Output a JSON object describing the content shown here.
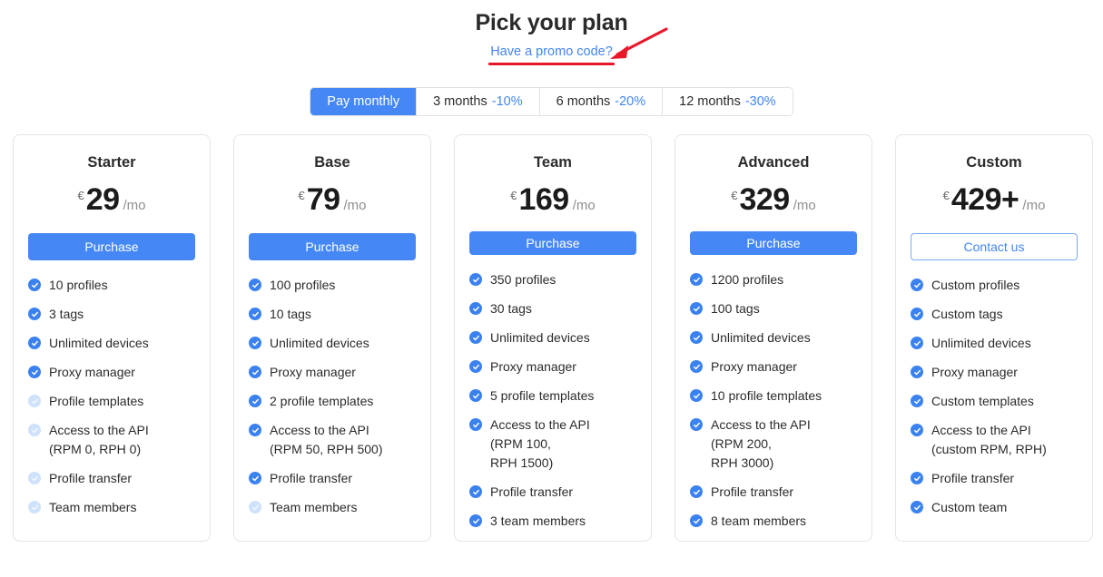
{
  "header": {
    "title": "Pick your plan",
    "promo_link": "Have a promo code?",
    "annotation_arrow": "red-arrow-pointing-to-promo-link",
    "accent_color": "#4285f4",
    "annotation_color": "#e8172a"
  },
  "billing_tabs": {
    "active_index": 0,
    "items": [
      {
        "label": "Pay monthly",
        "discount": ""
      },
      {
        "label": "3 months",
        "discount": "-10%"
      },
      {
        "label": "6 months",
        "discount": "-20%"
      },
      {
        "label": "12 months",
        "discount": "-30%"
      }
    ]
  },
  "plans": [
    {
      "name": "Starter",
      "currency": "€",
      "amount": "29",
      "period": "/mo",
      "cta_label": "Purchase",
      "cta_style": "primary",
      "features": [
        {
          "label": "10 profiles",
          "enabled": true
        },
        {
          "label": "3 tags",
          "enabled": true
        },
        {
          "label": "Unlimited devices",
          "enabled": true
        },
        {
          "label": "Proxy manager",
          "enabled": true
        },
        {
          "label": "Profile templates",
          "enabled": false
        },
        {
          "label": "Access to the API\n(RPM 0, RPH 0)",
          "enabled": false
        },
        {
          "label": "Profile transfer",
          "enabled": false
        },
        {
          "label": "Team members",
          "enabled": false
        }
      ]
    },
    {
      "name": "Base",
      "currency": "€",
      "amount": "79",
      "period": "/mo",
      "cta_label": "Purchase",
      "cta_style": "primary",
      "features": [
        {
          "label": "100 profiles",
          "enabled": true
        },
        {
          "label": "10 tags",
          "enabled": true
        },
        {
          "label": "Unlimited devices",
          "enabled": true
        },
        {
          "label": "Proxy manager",
          "enabled": true
        },
        {
          "label": "2 profile templates",
          "enabled": true
        },
        {
          "label": "Access to the API\n(RPM 50, RPH 500)",
          "enabled": true
        },
        {
          "label": "Profile transfer",
          "enabled": true
        },
        {
          "label": "Team members",
          "enabled": false
        }
      ]
    },
    {
      "name": "Team",
      "currency": "€",
      "amount": "169",
      "period": "/mo",
      "cta_label": "Purchase",
      "cta_style": "primary",
      "features": [
        {
          "label": "350 profiles",
          "enabled": true
        },
        {
          "label": "30 tags",
          "enabled": true
        },
        {
          "label": "Unlimited devices",
          "enabled": true
        },
        {
          "label": "Proxy manager",
          "enabled": true
        },
        {
          "label": "5 profile templates",
          "enabled": true
        },
        {
          "label": "Access to the API\n(RPM 100,\nRPH 1500)",
          "enabled": true
        },
        {
          "label": "Profile transfer",
          "enabled": true
        },
        {
          "label": "3 team members",
          "enabled": true
        }
      ]
    },
    {
      "name": "Advanced",
      "currency": "€",
      "amount": "329",
      "period": "/mo",
      "cta_label": "Purchase",
      "cta_style": "primary",
      "features": [
        {
          "label": "1200 profiles",
          "enabled": true
        },
        {
          "label": "100 tags",
          "enabled": true
        },
        {
          "label": "Unlimited devices",
          "enabled": true
        },
        {
          "label": "Proxy manager",
          "enabled": true
        },
        {
          "label": "10 profile templates",
          "enabled": true
        },
        {
          "label": "Access to the API\n(RPM 200,\nRPH 3000)",
          "enabled": true
        },
        {
          "label": "Profile transfer",
          "enabled": true
        },
        {
          "label": "8 team members",
          "enabled": true
        }
      ]
    },
    {
      "name": "Custom",
      "currency": "€",
      "amount": "429+",
      "period": "/mo",
      "cta_label": "Contact us",
      "cta_style": "outline",
      "features": [
        {
          "label": "Custom profiles",
          "enabled": true
        },
        {
          "label": "Custom tags",
          "enabled": true
        },
        {
          "label": "Unlimited devices",
          "enabled": true
        },
        {
          "label": "Proxy manager",
          "enabled": true
        },
        {
          "label": "Custom templates",
          "enabled": true
        },
        {
          "label": "Access to the API\n(custom RPM, RPH)",
          "enabled": true
        },
        {
          "label": "Profile transfer",
          "enabled": true
        },
        {
          "label": "Custom team",
          "enabled": true
        }
      ]
    }
  ]
}
